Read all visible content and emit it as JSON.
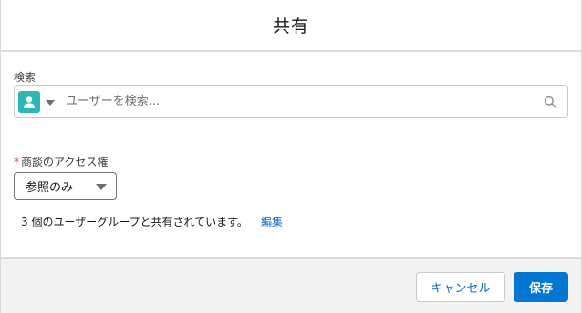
{
  "modal": {
    "title": "共有"
  },
  "search": {
    "label": "検索",
    "placeholder": "ユーザーを検索...",
    "value": ""
  },
  "access": {
    "required_mark": "*",
    "label": "商談のアクセス権",
    "selected": "参照のみ"
  },
  "shared_info": {
    "text": "3 個のユーザーグループと共有されています。",
    "edit_link": "編集"
  },
  "footer": {
    "cancel_label": "キャンセル",
    "save_label": "保存"
  },
  "colors": {
    "brand": "#0176d3",
    "link": "#0b6ec3",
    "avatar": "#2bb8b3",
    "required": "#c23934",
    "footer_bg": "#f3f3f3"
  },
  "icons": {
    "avatar": "user-avatar-icon",
    "entity_picker": "chevron-down-icon",
    "search": "search-icon",
    "select_caret": "chevron-down-icon"
  }
}
